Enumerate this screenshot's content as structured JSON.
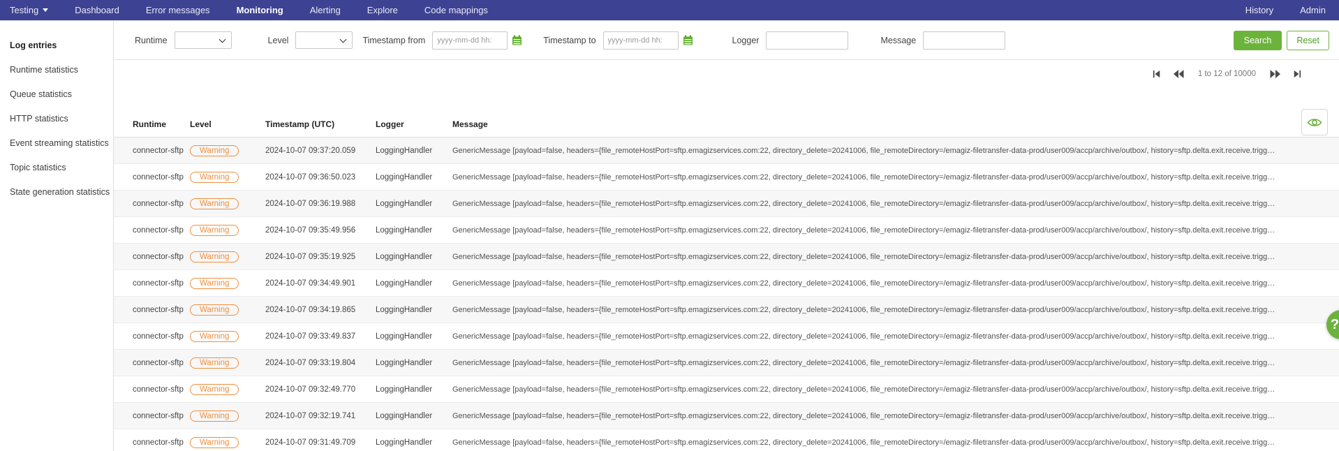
{
  "nav": {
    "items": [
      {
        "label": "Testing",
        "has_dropdown": true
      },
      {
        "label": "Dashboard"
      },
      {
        "label": "Error messages"
      },
      {
        "label": "Monitoring",
        "active": true
      },
      {
        "label": "Alerting"
      },
      {
        "label": "Explore"
      },
      {
        "label": "Code mappings"
      }
    ],
    "right_items": [
      "History",
      "Admin"
    ]
  },
  "sidebar": {
    "items": [
      {
        "label": "Log entries",
        "active": true
      },
      {
        "label": "Runtime statistics"
      },
      {
        "label": "Queue statistics"
      },
      {
        "label": "HTTP statistics"
      },
      {
        "label": "Event streaming statistics"
      },
      {
        "label": "Topic statistics"
      },
      {
        "label": "State generation statistics"
      }
    ]
  },
  "filters": {
    "runtime_label": "Runtime",
    "runtime_value": "",
    "level_label": "Level",
    "level_value": "",
    "timestamp_from_label": "Timestamp from",
    "timestamp_to_label": "Timestamp to",
    "timestamp_placeholder": "yyyy-mm-dd hh:",
    "timestamp_from_value": "",
    "timestamp_to_value": "",
    "logger_label": "Logger",
    "logger_value": "",
    "message_label": "Message",
    "message_value": "",
    "search_label": "Search",
    "reset_label": "Reset"
  },
  "pagination": {
    "range_text": "1 to 12 of 10000"
  },
  "table": {
    "columns": [
      "Runtime",
      "Level",
      "Timestamp (UTC)",
      "Logger",
      "Message"
    ],
    "rows": [
      {
        "runtime": "connector-sftp",
        "level": "Warning",
        "timestamp": "2024-10-07 09:37:20.059",
        "logger": "LoggingHandler",
        "message": "GenericMessage [payload=false, headers={file_remoteHostPort=sftp.emagizservices.com:22, directory_delete=20241006, file_remoteDirectory=/emagiz-filetransfer-data-prod/user009/accp/archive/outbox/, history=sftp.delta.exit.receive.trigg…"
      },
      {
        "runtime": "connector-sftp",
        "level": "Warning",
        "timestamp": "2024-10-07 09:36:50.023",
        "logger": "LoggingHandler",
        "message": "GenericMessage [payload=false, headers={file_remoteHostPort=sftp.emagizservices.com:22, directory_delete=20241006, file_remoteDirectory=/emagiz-filetransfer-data-prod/user009/accp/archive/outbox/, history=sftp.delta.exit.receive.trigg…"
      },
      {
        "runtime": "connector-sftp",
        "level": "Warning",
        "timestamp": "2024-10-07 09:36:19.988",
        "logger": "LoggingHandler",
        "message": "GenericMessage [payload=false, headers={file_remoteHostPort=sftp.emagizservices.com:22, directory_delete=20241006, file_remoteDirectory=/emagiz-filetransfer-data-prod/user009/accp/archive/outbox/, history=sftp.delta.exit.receive.trigg…"
      },
      {
        "runtime": "connector-sftp",
        "level": "Warning",
        "timestamp": "2024-10-07 09:35:49.956",
        "logger": "LoggingHandler",
        "message": "GenericMessage [payload=false, headers={file_remoteHostPort=sftp.emagizservices.com:22, directory_delete=20241006, file_remoteDirectory=/emagiz-filetransfer-data-prod/user009/accp/archive/outbox/, history=sftp.delta.exit.receive.trigg…"
      },
      {
        "runtime": "connector-sftp",
        "level": "Warning",
        "timestamp": "2024-10-07 09:35:19.925",
        "logger": "LoggingHandler",
        "message": "GenericMessage [payload=false, headers={file_remoteHostPort=sftp.emagizservices.com:22, directory_delete=20241006, file_remoteDirectory=/emagiz-filetransfer-data-prod/user009/accp/archive/outbox/, history=sftp.delta.exit.receive.trigg…"
      },
      {
        "runtime": "connector-sftp",
        "level": "Warning",
        "timestamp": "2024-10-07 09:34:49.901",
        "logger": "LoggingHandler",
        "message": "GenericMessage [payload=false, headers={file_remoteHostPort=sftp.emagizservices.com:22, directory_delete=20241006, file_remoteDirectory=/emagiz-filetransfer-data-prod/user009/accp/archive/outbox/, history=sftp.delta.exit.receive.trigg…"
      },
      {
        "runtime": "connector-sftp",
        "level": "Warning",
        "timestamp": "2024-10-07 09:34:19.865",
        "logger": "LoggingHandler",
        "message": "GenericMessage [payload=false, headers={file_remoteHostPort=sftp.emagizservices.com:22, directory_delete=20241006, file_remoteDirectory=/emagiz-filetransfer-data-prod/user009/accp/archive/outbox/, history=sftp.delta.exit.receive.trigg…"
      },
      {
        "runtime": "connector-sftp",
        "level": "Warning",
        "timestamp": "2024-10-07 09:33:49.837",
        "logger": "LoggingHandler",
        "message": "GenericMessage [payload=false, headers={file_remoteHostPort=sftp.emagizservices.com:22, directory_delete=20241006, file_remoteDirectory=/emagiz-filetransfer-data-prod/user009/accp/archive/outbox/, history=sftp.delta.exit.receive.trigg…"
      },
      {
        "runtime": "connector-sftp",
        "level": "Warning",
        "timestamp": "2024-10-07 09:33:19.804",
        "logger": "LoggingHandler",
        "message": "GenericMessage [payload=false, headers={file_remoteHostPort=sftp.emagizservices.com:22, directory_delete=20241006, file_remoteDirectory=/emagiz-filetransfer-data-prod/user009/accp/archive/outbox/, history=sftp.delta.exit.receive.trigg…"
      },
      {
        "runtime": "connector-sftp",
        "level": "Warning",
        "timestamp": "2024-10-07 09:32:49.770",
        "logger": "LoggingHandler",
        "message": "GenericMessage [payload=false, headers={file_remoteHostPort=sftp.emagizservices.com:22, directory_delete=20241006, file_remoteDirectory=/emagiz-filetransfer-data-prod/user009/accp/archive/outbox/, history=sftp.delta.exit.receive.trigg…"
      },
      {
        "runtime": "connector-sftp",
        "level": "Warning",
        "timestamp": "2024-10-07 09:32:19.741",
        "logger": "LoggingHandler",
        "message": "GenericMessage [payload=false, headers={file_remoteHostPort=sftp.emagizservices.com:22, directory_delete=20241006, file_remoteDirectory=/emagiz-filetransfer-data-prod/user009/accp/archive/outbox/, history=sftp.delta.exit.receive.trigg…"
      },
      {
        "runtime": "connector-sftp",
        "level": "Warning",
        "timestamp": "2024-10-07 09:31:49.709",
        "logger": "LoggingHandler",
        "message": "GenericMessage [payload=false, headers={file_remoteHostPort=sftp.emagizservices.com:22, directory_delete=20241006, file_remoteDirectory=/emagiz-filetransfer-data-prod/user009/accp/archive/outbox/, history=sftp.delta.exit.receive.trigg…"
      }
    ]
  },
  "icons": {
    "dropdown_caret": "caret-down",
    "calendar": "calendar-icon",
    "eye": "eye-icon",
    "first_page": "first-page-icon",
    "fast_backward": "fast-backward-icon",
    "fast_forward": "fast-forward-icon",
    "last_page": "last-page-icon",
    "help": "question-mark"
  },
  "colors": {
    "nav_bg": "#3e4292",
    "accent_green": "#6cb33c",
    "warning_orange": "#ef8e3c"
  }
}
